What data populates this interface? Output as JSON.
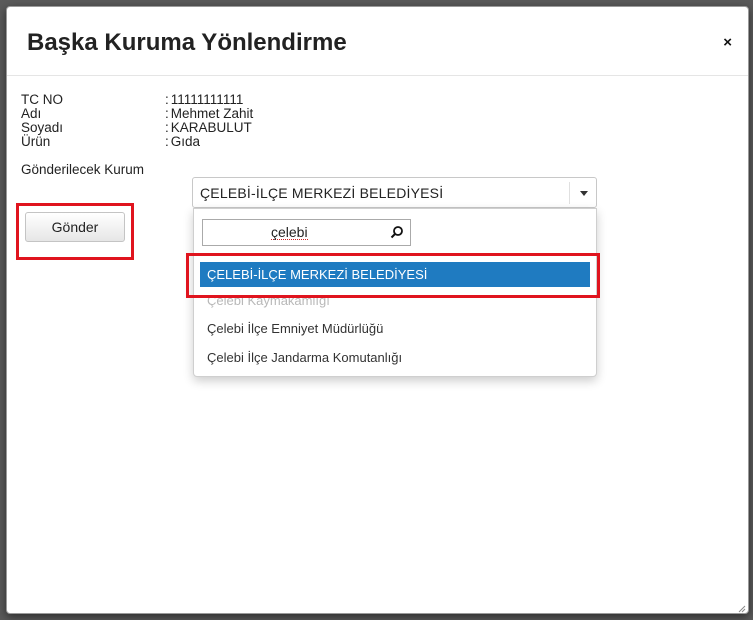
{
  "modal": {
    "title": "Başka Kuruma Yönlendirme",
    "close_icon": "×"
  },
  "info": {
    "separator": ":",
    "rows": [
      {
        "label": "TC NO",
        "value": "11111111111"
      },
      {
        "label": "Adı",
        "value": "Mehmet Zahit"
      },
      {
        "label": "Soyadı",
        "value": "KARABULUT"
      },
      {
        "label": "Ürün",
        "value": "Gıda"
      }
    ],
    "institution_label": "Gönderilecek Kurum"
  },
  "select": {
    "value": "ÇELEBİ-İLÇE MERKEZİ BELEDİYESİ"
  },
  "dropdown": {
    "search_value": "çelebi",
    "options": [
      {
        "label": "ÇELEBİ-İLÇE MERKEZİ BELEDİYESİ",
        "selected": true
      },
      {
        "label": "Çelebi Kaymakamlığı",
        "selected": false
      },
      {
        "label": "Çelebi İlçe Emniyet Müdürlüğü",
        "selected": false
      },
      {
        "label": "Çelebi İlçe Jandarma Komutanlığı",
        "selected": false
      }
    ]
  },
  "actions": {
    "send_label": "Gönder"
  },
  "colors": {
    "highlight": "#e0141e",
    "selected_option": "#1f7bc1"
  }
}
